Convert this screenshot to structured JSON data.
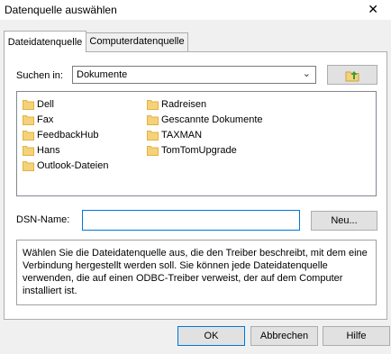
{
  "window": {
    "title": "Datenquelle auswählen",
    "close_glyph": "✕"
  },
  "tabs": [
    {
      "label": "Dateidatenquelle"
    },
    {
      "label": "Computerdatenquelle"
    }
  ],
  "search": {
    "label": "Suchen in:",
    "value": "Dokumente",
    "up_icon": "folder-up-icon"
  },
  "files": [
    {
      "name": "Dell"
    },
    {
      "name": "Fax"
    },
    {
      "name": "FeedbackHub"
    },
    {
      "name": "Hans"
    },
    {
      "name": "Outlook-Dateien"
    },
    {
      "name": "Radreisen"
    },
    {
      "name": "Gescannte Dokumente"
    },
    {
      "name": "TAXMAN"
    },
    {
      "name": "TomTomUpgrade"
    }
  ],
  "dsn": {
    "label": "DSN-Name:",
    "value": "",
    "new_button": "Neu..."
  },
  "description": "Wählen Sie die Dateidatenquelle aus, die den Treiber beschreibt, mit dem eine Verbindung hergestellt werden soll. Sie können jede Dateidatenquelle verwenden, die auf einen ODBC-Treiber verweist, der auf dem Computer installiert ist.",
  "buttons": {
    "ok": "OK",
    "cancel": "Abbrechen",
    "help": "Hilfe"
  },
  "colors": {
    "folder": "#f5d27a",
    "accent": "#0078d7"
  }
}
